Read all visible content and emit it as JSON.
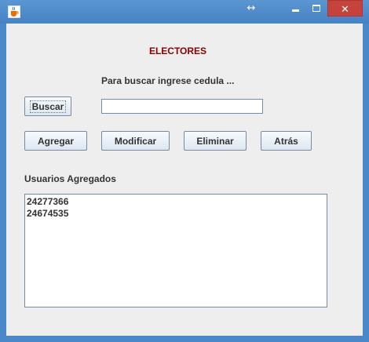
{
  "window": {
    "title": "",
    "icons": {
      "app": "java-cup-icon",
      "resize": "resize-arrows-icon",
      "minimize": "minimize-icon",
      "maximize": "maximize-icon",
      "close": "close-icon"
    },
    "resize_glyph": "↔",
    "close_glyph": "✕"
  },
  "form": {
    "heading": "ELECTORES",
    "hint": "Para buscar ingrese cedula ...",
    "search_button": "Buscar",
    "search_value": "",
    "add_button": "Agregar",
    "modify_button": "Modificar",
    "delete_button": "Eliminar",
    "back_button": "Atrás",
    "list_label": "Usuarios Agregados",
    "users": [
      "24277366",
      "24674535"
    ]
  },
  "colors": {
    "heading": "#8b0000",
    "titlebar": "#4a88c9",
    "close": "#c7423b",
    "panel": "#eeeeee"
  }
}
